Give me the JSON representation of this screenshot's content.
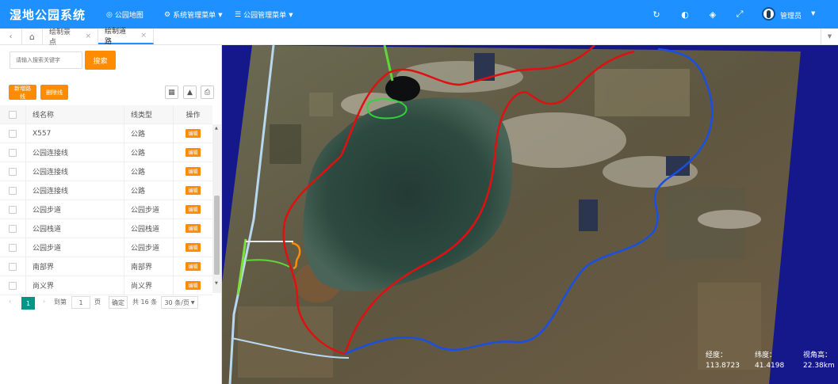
{
  "header": {
    "title": "湿地公园系统",
    "menus": [
      {
        "icon": "globe-icon",
        "label": "公园地图"
      },
      {
        "icon": "gear-icon",
        "label": "系统管理菜单"
      },
      {
        "icon": "list-icon",
        "label": "公园管理菜单"
      }
    ],
    "user": "管理员"
  },
  "tabs": [
    {
      "label": "绘制景点"
    },
    {
      "label": "绘制道路"
    }
  ],
  "search": {
    "placeholder": "请输入搜索关键字",
    "button": "搜索"
  },
  "actions": {
    "add": "新增路线",
    "delete": "删除线"
  },
  "table": {
    "columns": [
      "线名称",
      "线类型",
      "操作"
    ],
    "edit_label": "编辑",
    "rows": [
      {
        "name": "X557",
        "type": "公路"
      },
      {
        "name": "公园连接线",
        "type": "公路"
      },
      {
        "name": "公园连接线",
        "type": "公路"
      },
      {
        "name": "公园连接线",
        "type": "公路"
      },
      {
        "name": "公园步道",
        "type": "公园步道"
      },
      {
        "name": "公园栈道",
        "type": "公园栈道"
      },
      {
        "name": "公园步道",
        "type": "公园步道"
      },
      {
        "name": "南部界",
        "type": "南部界"
      },
      {
        "name": "尚义界",
        "type": "尚义界"
      }
    ]
  },
  "pagination": {
    "current": "1",
    "goto_label": "到第",
    "input_value": "1",
    "page_label": "页",
    "confirm": "确定",
    "total": "共 16 条",
    "page_size": "30 条/页"
  },
  "map": {
    "readout": [
      {
        "label": "经度：",
        "value": "113.8723"
      },
      {
        "label": "纬度：",
        "value": "41.4198"
      },
      {
        "label": "视角高：",
        "value": "22.38km"
      }
    ],
    "colors": {
      "red_boundary": "#e01010",
      "blue_boundary": "#1a4fe0",
      "road": "#b8d8f0",
      "green_path": "#5fd63a",
      "orange_path": "#ff8c00"
    }
  }
}
